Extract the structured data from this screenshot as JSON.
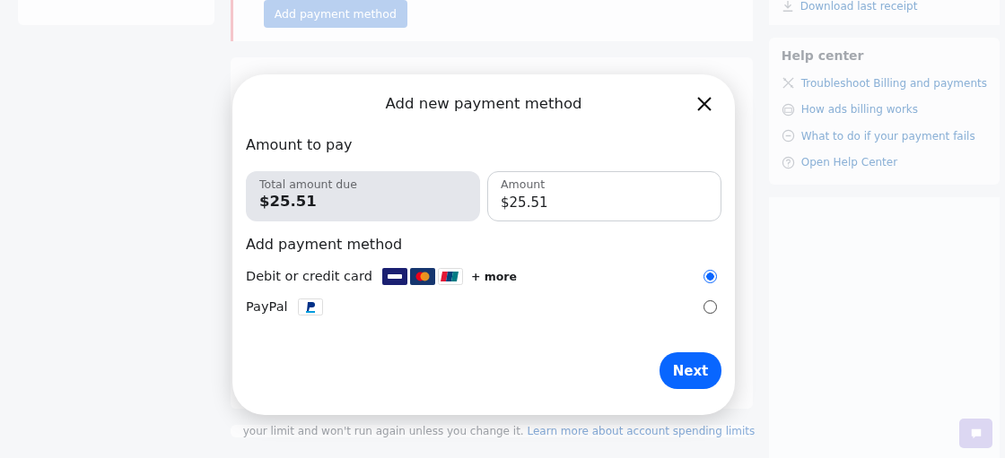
{
  "background": {
    "add_payment_button": "Add payment method",
    "receipt_link": "Download last receipt",
    "help_center": {
      "title": "Help center",
      "links": [
        {
          "kind": "tools",
          "label": "Troubleshoot Billing and payments"
        },
        {
          "kind": "wallet",
          "label": "How ads billing works"
        },
        {
          "kind": "minus",
          "label": "What to do if your payment fails"
        },
        {
          "kind": "question",
          "label": "Open Help Center"
        }
      ]
    },
    "spending_note": {
      "text": "your limit and won't run again unless you change it.",
      "link": "Learn more about account spending limits"
    }
  },
  "dialog": {
    "title": "Add new payment method",
    "amount_section": "Amount to pay",
    "total_due": {
      "label": "Total amount due",
      "value": "$25.51"
    },
    "amount_field": {
      "label": "Amount",
      "value": "$25.51"
    },
    "method_section": "Add payment method",
    "methods": [
      {
        "kind": "card",
        "label": "Debit or credit card",
        "more": "+ more",
        "selected": true
      },
      {
        "kind": "paypal",
        "label": "PayPal",
        "selected": false
      }
    ],
    "next_button": "Next"
  }
}
